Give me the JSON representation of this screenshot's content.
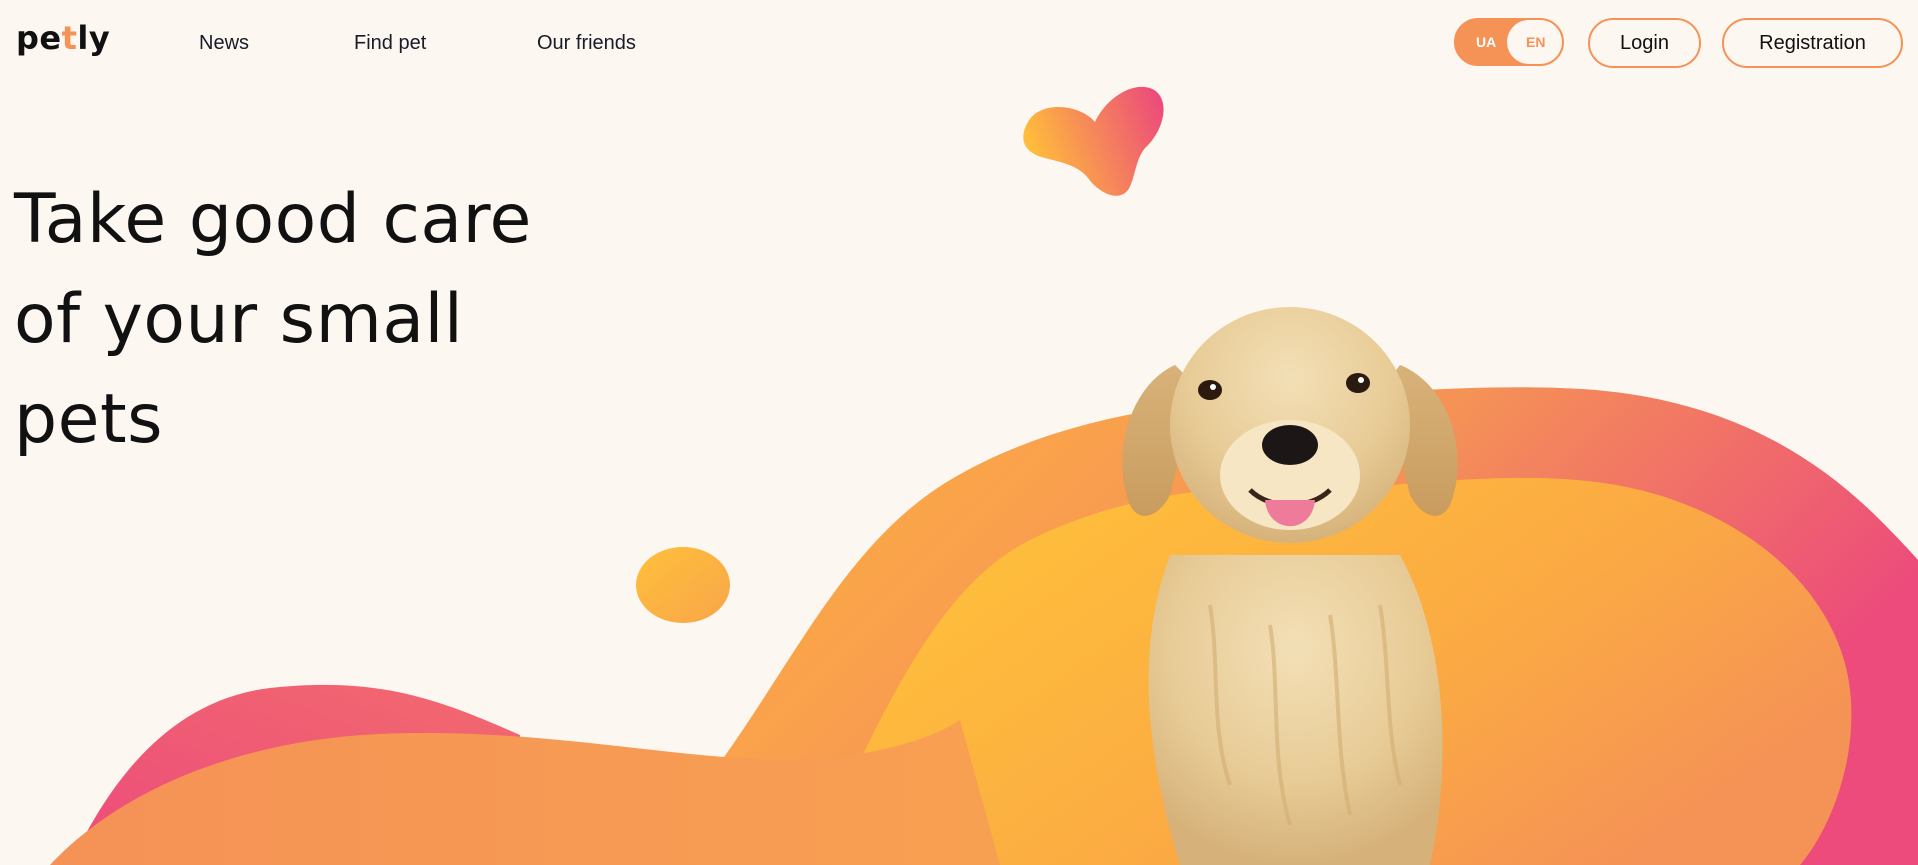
{
  "header": {
    "logo": {
      "part1": "pe",
      "accent": "t",
      "part2": "ly"
    },
    "nav": [
      {
        "label": "News"
      },
      {
        "label": "Find pet"
      },
      {
        "label": "Our friends"
      }
    ],
    "language": {
      "options": [
        "UA",
        "EN"
      ],
      "selected": "UA"
    },
    "login_label": "Login",
    "register_label": "Registration"
  },
  "hero": {
    "title_line1": "Take good care",
    "title_line2": "of your small",
    "title_line3": "pets"
  },
  "colors": {
    "accent": "#f59256",
    "background": "#fdf7f2",
    "gradient_yellow": "#ffc03a",
    "gradient_orange": "#f59256",
    "gradient_pink": "#ec4b7b"
  },
  "images": {
    "hero_image": "golden-retriever-dog"
  }
}
